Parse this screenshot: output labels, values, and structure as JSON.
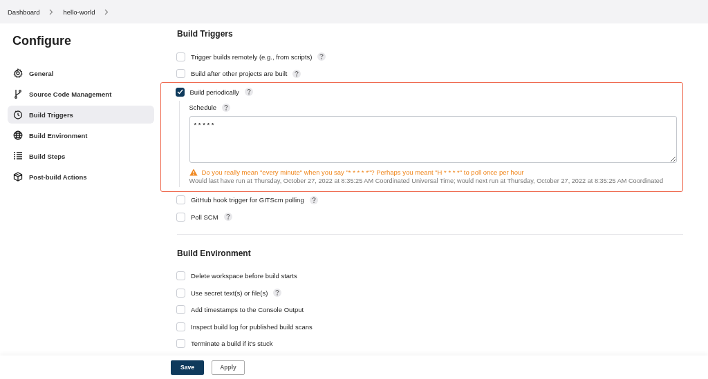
{
  "breadcrumbs": [
    "Dashboard",
    "hello-world"
  ],
  "sidebar": {
    "title": "Configure",
    "items": [
      {
        "label": "General",
        "selected": false
      },
      {
        "label": "Source Code Management",
        "selected": false
      },
      {
        "label": "Build Triggers",
        "selected": true
      },
      {
        "label": "Build Environment",
        "selected": false
      },
      {
        "label": "Build Steps",
        "selected": false
      },
      {
        "label": "Post-build Actions",
        "selected": false
      }
    ]
  },
  "sections": [
    {
      "title": "Build Triggers",
      "options": [
        {
          "label": "Trigger builds remotely (e.g., from scripts)",
          "checked": false,
          "help": true
        },
        {
          "label": "Build after other projects are built",
          "checked": false,
          "help": true
        },
        {
          "label": "Build periodically",
          "checked": true,
          "help": true,
          "highlighted": true,
          "schedule": {
            "label": "Schedule",
            "value": "* * * * *",
            "warning": "Do you really mean \"every minute\" when you say \"* * * * *\"? Perhaps you meant \"H * * * *\" to poll once per hour",
            "info": "Would last have run at Thursday, October 27, 2022 at 8:35:25 AM Coordinated Universal Time; would next run at Thursday, October 27, 2022 at 8:35:25 AM Coordinated"
          }
        },
        {
          "label": "GitHub hook trigger for GITScm polling",
          "checked": false,
          "help": true
        },
        {
          "label": "Poll SCM",
          "checked": false,
          "help": true
        }
      ]
    },
    {
      "title": "Build Environment",
      "options": [
        {
          "label": "Delete workspace before build starts",
          "checked": false,
          "help": false
        },
        {
          "label": "Use secret text(s) or file(s)",
          "checked": false,
          "help": true
        },
        {
          "label": "Add timestamps to the Console Output",
          "checked": false,
          "help": false
        },
        {
          "label": "Inspect build log for published build scans",
          "checked": false,
          "help": false
        },
        {
          "label": "Terminate a build if it's stuck",
          "checked": false,
          "help": false
        }
      ]
    }
  ],
  "buttons": [
    "Save",
    "Apply"
  ]
}
